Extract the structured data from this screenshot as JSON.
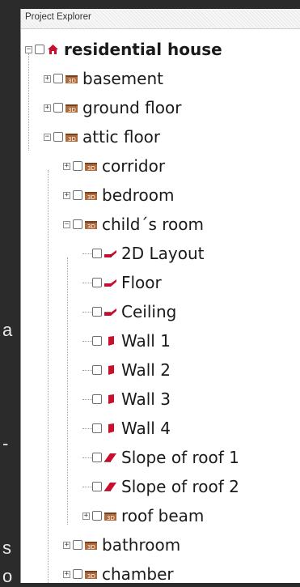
{
  "panel": {
    "title": "Project Explorer"
  },
  "backdrop": {
    "fragments": [
      "a",
      "-",
      "s",
      "o"
    ]
  },
  "colors": {
    "accent_red": "#c8102e",
    "folder_brown": "#b06a3a",
    "tree_line": "#a0a0a0"
  },
  "tree": [
    {
      "label": "residential house",
      "bold": true,
      "icon": "house-icon",
      "level": 0,
      "expander": "minus"
    },
    {
      "label": "basement",
      "icon": "3d-room-icon",
      "level": 1,
      "expander": "plus"
    },
    {
      "label": "ground floor",
      "icon": "3d-room-icon",
      "level": 1,
      "expander": "plus"
    },
    {
      "label": "attic floor",
      "icon": "3d-room-icon",
      "level": 1,
      "expander": "minus"
    },
    {
      "label": "corridor",
      "icon": "3d-room-icon",
      "level": 2,
      "expander": "plus"
    },
    {
      "label": "bedroom",
      "icon": "3d-room-icon",
      "level": 2,
      "expander": "plus"
    },
    {
      "label": "child´s room",
      "icon": "3d-room-icon",
      "level": 2,
      "expander": "minus"
    },
    {
      "label": "2D Layout",
      "icon": "layout-2d-icon",
      "level": 3,
      "expander": "none"
    },
    {
      "label": "Floor",
      "icon": "floor-icon",
      "level": 3,
      "expander": "none"
    },
    {
      "label": "Ceiling",
      "icon": "ceiling-icon",
      "level": 3,
      "expander": "none"
    },
    {
      "label": "Wall 1",
      "icon": "wall-icon",
      "level": 3,
      "expander": "none"
    },
    {
      "label": "Wall 2",
      "icon": "wall-icon",
      "level": 3,
      "expander": "none"
    },
    {
      "label": "Wall 3",
      "icon": "wall-icon",
      "level": 3,
      "expander": "none"
    },
    {
      "label": "Wall 4",
      "icon": "wall-icon",
      "level": 3,
      "expander": "none"
    },
    {
      "label": "Slope of roof 1",
      "icon": "roof-slope-icon",
      "level": 3,
      "expander": "none"
    },
    {
      "label": "Slope of roof 2",
      "icon": "roof-slope-icon",
      "level": 3,
      "expander": "none"
    },
    {
      "label": "roof beam",
      "icon": "3d-room-icon",
      "level": 3,
      "expander": "plus"
    },
    {
      "label": "bathroom",
      "icon": "3d-room-icon",
      "level": 2,
      "expander": "plus"
    },
    {
      "label": "chamber",
      "icon": "3d-room-icon",
      "level": 2,
      "expander": "plus"
    }
  ]
}
